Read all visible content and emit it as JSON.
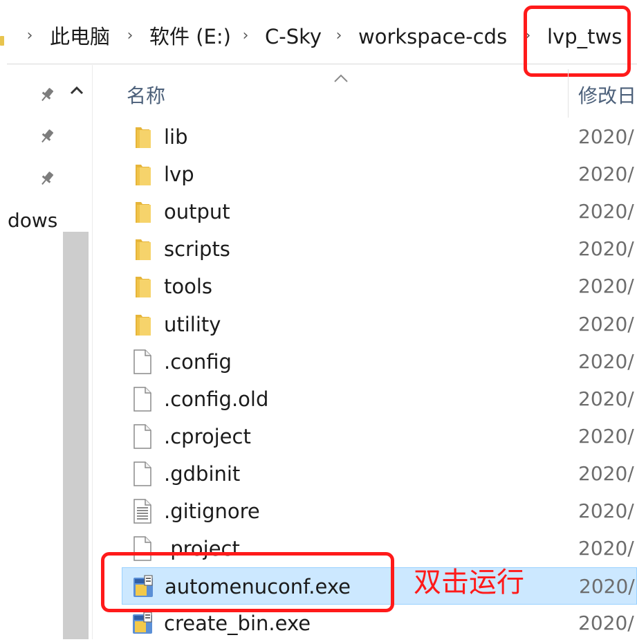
{
  "breadcrumb": {
    "items": [
      {
        "label": "此电脑"
      },
      {
        "label": "软件 (E:)"
      },
      {
        "label": "C-Sky"
      },
      {
        "label": "workspace-cds"
      },
      {
        "label": "lvp_tws"
      }
    ]
  },
  "nav": {
    "partial_item": "dows"
  },
  "columns": {
    "name": "名称",
    "date": "修改日"
  },
  "files": [
    {
      "name": "lib",
      "date": "2020/",
      "type": "folder"
    },
    {
      "name": "lvp",
      "date": "2020/",
      "type": "folder"
    },
    {
      "name": "output",
      "date": "2020/",
      "type": "folder"
    },
    {
      "name": "scripts",
      "date": "2020/",
      "type": "folder"
    },
    {
      "name": "tools",
      "date": "2020/",
      "type": "folder"
    },
    {
      "name": "utility",
      "date": "2020/",
      "type": "folder"
    },
    {
      "name": ".config",
      "date": "2020/",
      "type": "file"
    },
    {
      "name": ".config.old",
      "date": "2020/",
      "type": "file"
    },
    {
      "name": ".cproject",
      "date": "2020/",
      "type": "file"
    },
    {
      "name": ".gdbinit",
      "date": "2020/",
      "type": "file"
    },
    {
      "name": ".gitignore",
      "date": "2020/",
      "type": "text"
    },
    {
      "name": ".project",
      "date": "2020/",
      "type": "file"
    },
    {
      "name": "automenuconf.exe",
      "date": "2020/",
      "type": "exe",
      "selected": true
    },
    {
      "name": "create_bin.exe",
      "date": "2020/",
      "type": "exe"
    }
  ],
  "annotation": {
    "text": "双击运行",
    "color": "#ff1a1a"
  },
  "colors": {
    "selection_bg": "#cce8ff",
    "selection_border": "#99d1ff",
    "folder": "#f2c94c",
    "header_text": "#4c607a"
  }
}
